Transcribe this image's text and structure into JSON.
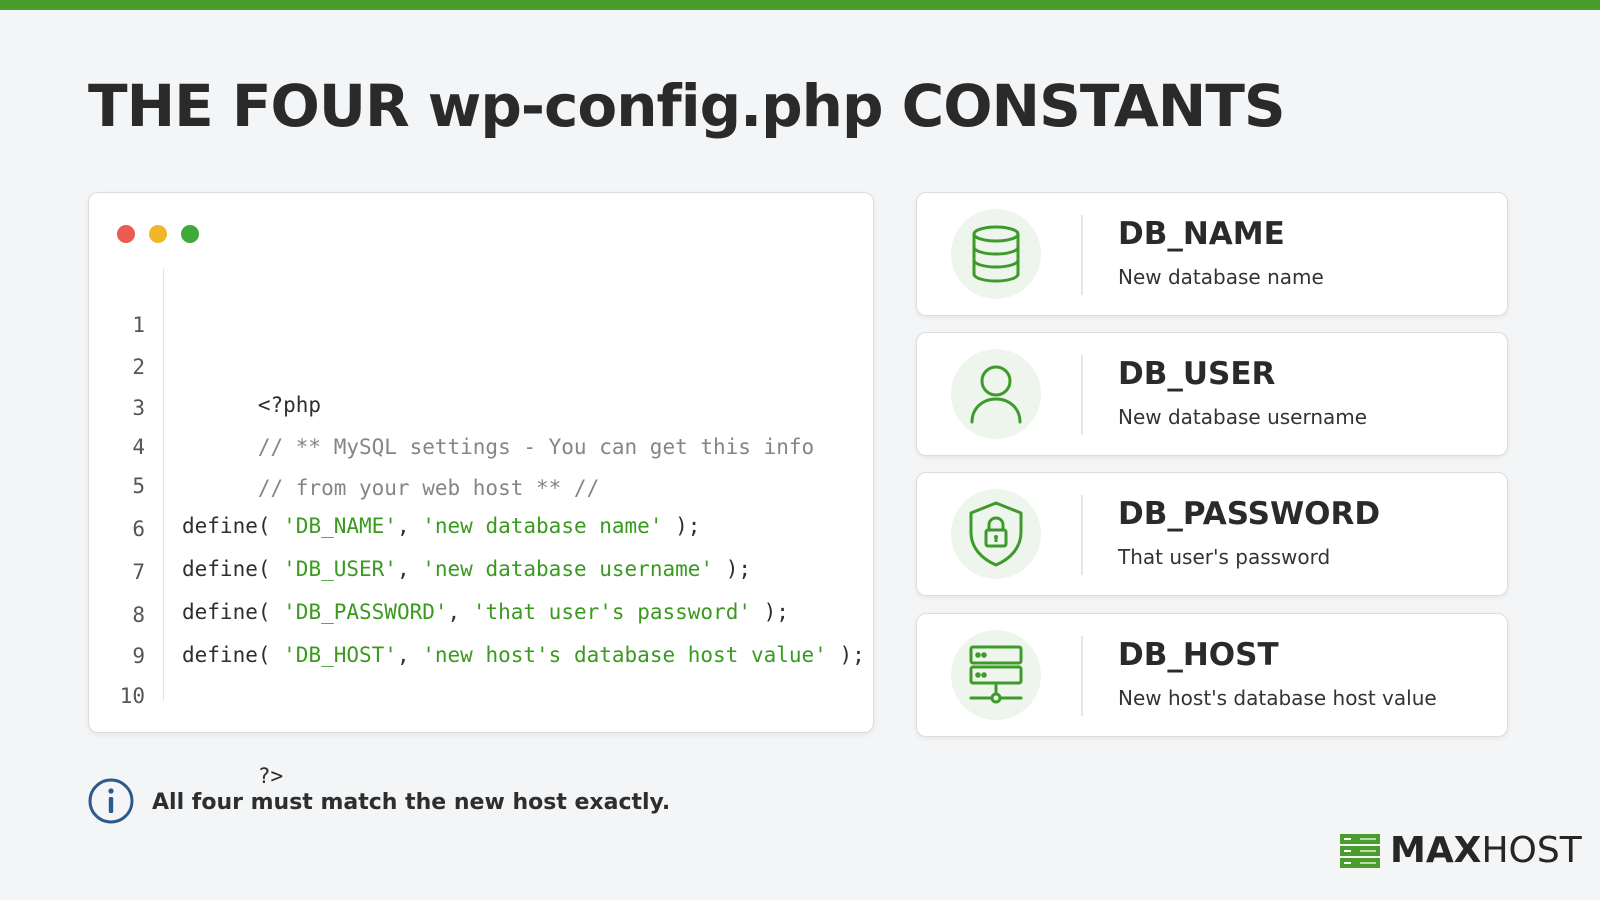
{
  "title": "THE FOUR wp-config.php CONSTANTS",
  "editor": {
    "lines": [
      {
        "num": "1",
        "segments": [
          {
            "text": "<?php",
            "kind": "plain"
          }
        ]
      },
      {
        "num": "2",
        "segments": [
          {
            "text": "// ** MySQL settings - You can get this info",
            "kind": "comment"
          }
        ]
      },
      {
        "num": "3",
        "segments": [
          {
            "text": "// from your web host ** //",
            "kind": "comment"
          }
        ]
      },
      {
        "num": "4",
        "segments": []
      },
      {
        "num": "5",
        "segments": [
          {
            "text": "define( ",
            "kind": "plain"
          },
          {
            "text": "'DB_NAME'",
            "kind": "string"
          },
          {
            "text": ", ",
            "kind": "plain"
          },
          {
            "text": "'new database name'",
            "kind": "string"
          },
          {
            "text": " );",
            "kind": "plain"
          }
        ]
      },
      {
        "num": "6",
        "segments": [
          {
            "text": "define( ",
            "kind": "plain"
          },
          {
            "text": "'DB_USER'",
            "kind": "string"
          },
          {
            "text": ", ",
            "kind": "plain"
          },
          {
            "text": "'new database username'",
            "kind": "string"
          },
          {
            "text": " );",
            "kind": "plain"
          }
        ]
      },
      {
        "num": "7",
        "segments": [
          {
            "text": "define( ",
            "kind": "plain"
          },
          {
            "text": "'DB_PASSWORD'",
            "kind": "string"
          },
          {
            "text": ", ",
            "kind": "plain"
          },
          {
            "text": "'that user's password'",
            "kind": "string"
          },
          {
            "text": " );",
            "kind": "plain"
          }
        ]
      },
      {
        "num": "8",
        "segments": [
          {
            "text": "define( ",
            "kind": "plain"
          },
          {
            "text": "'DB_HOST'",
            "kind": "string"
          },
          {
            "text": ", ",
            "kind": "plain"
          },
          {
            "text": "'new host's database host value'",
            "kind": "string"
          },
          {
            "text": " );",
            "kind": "plain"
          }
        ]
      },
      {
        "num": "9",
        "segments": []
      },
      {
        "num": "10",
        "segments": [
          {
            "text": "?>",
            "kind": "plain"
          }
        ]
      }
    ]
  },
  "constants": [
    {
      "name": "DB_NAME",
      "description": "New database name",
      "icon": "database-icon"
    },
    {
      "name": "DB_USER",
      "description": "New database username",
      "icon": "user-icon"
    },
    {
      "name": "DB_PASSWORD",
      "description": "That user's password",
      "icon": "shield-lock-icon"
    },
    {
      "name": "DB_HOST",
      "description": "New host's database host value",
      "icon": "server-icon"
    }
  ],
  "note": "All four must match the new host exactly.",
  "logo": {
    "bold": "MAX",
    "light": "HOST"
  },
  "colors": {
    "accent": "#4a9c2d",
    "string": "#3a9a1f",
    "comment": "#858585",
    "info": "#2d5a8c"
  }
}
